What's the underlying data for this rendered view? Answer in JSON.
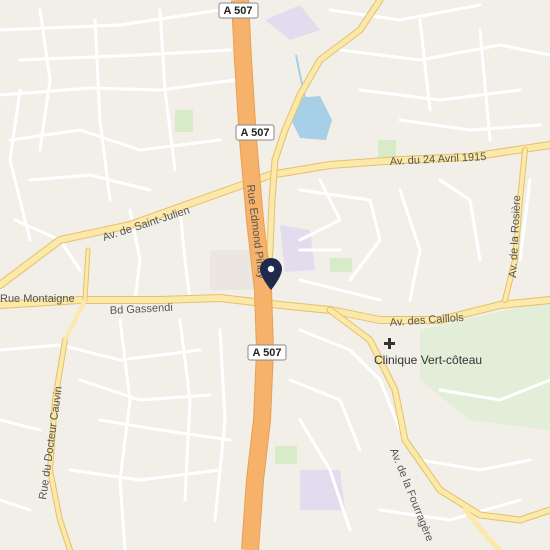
{
  "map": {
    "road_shields": [
      {
        "id": "a507-top",
        "text": "A 507"
      },
      {
        "id": "a507-mid",
        "text": "A 507"
      },
      {
        "id": "a507-low",
        "text": "A 507"
      }
    ],
    "street_labels": {
      "av_24_avril": "Av. du 24 Avril 1915",
      "av_saint_julien": "Av. de Saint-Julien",
      "rue_edmond_pinay": "Rue Edmond Pinay",
      "rue_montaigne": "Rue Montaigne",
      "bd_gassendi": "Bd Gassendi",
      "av_caillols": "Av. des Caillols",
      "av_rosiere": "Av. de la Rosière",
      "rue_docteur_cauvin": "Rue du Docteur Cauvin",
      "av_fourragere": "Av. de la Fourragère"
    },
    "poi": {
      "label": "Clinique Vert-côteau",
      "icon": "hospital-cross-icon"
    },
    "marker": {
      "icon": "map-pin-icon",
      "color": "#1f2a4d"
    },
    "colors": {
      "land": "#f2efe9",
      "motorway": "#f6b26b",
      "primary": "#fce8a8",
      "minor": "#ffffff",
      "water": "#a8cfe8",
      "park": "#d8ebc8"
    }
  }
}
